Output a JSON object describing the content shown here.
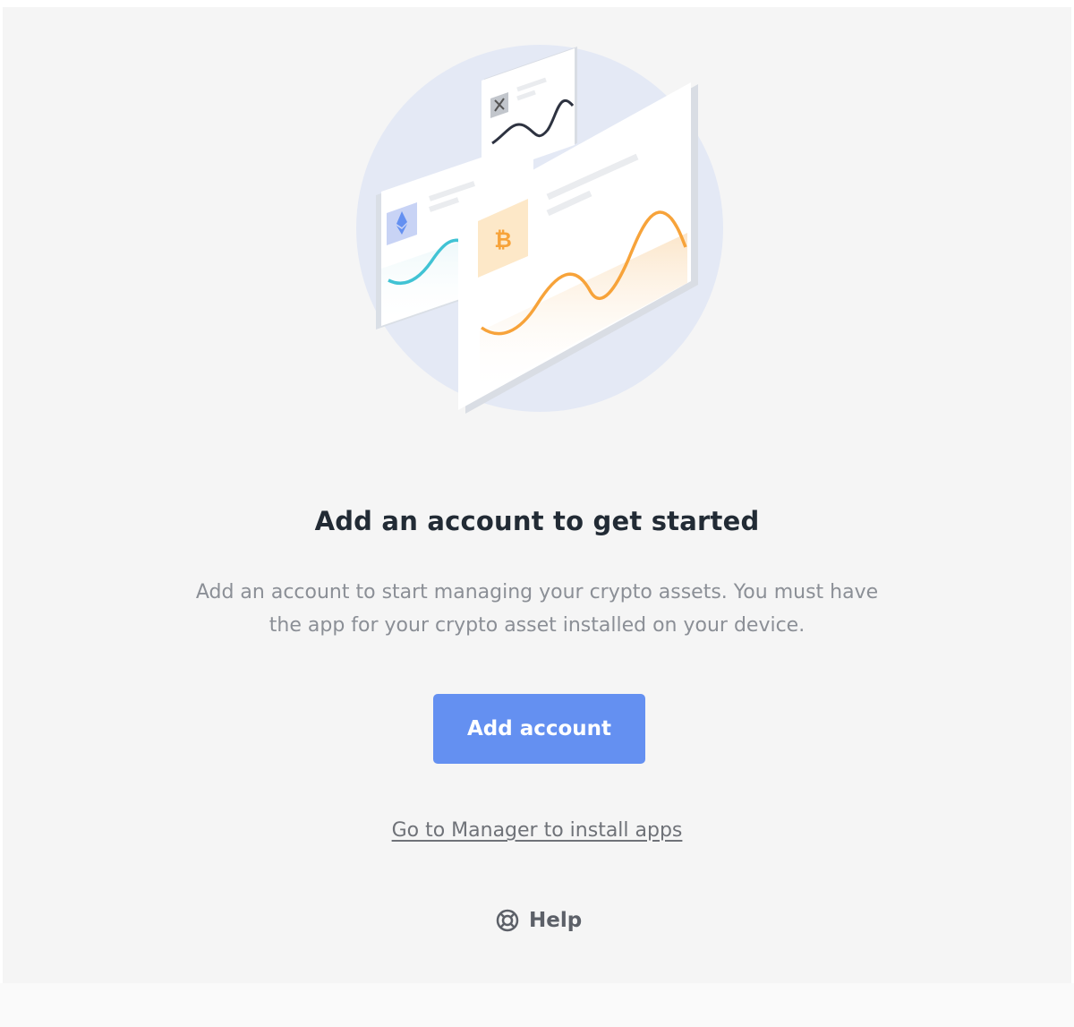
{
  "empty_state": {
    "title": "Add an account to get started",
    "description_line1": "Add an account to start managing your crypto assets. You must have",
    "description_line2": "the app for your crypto asset installed on your device.",
    "add_account_label": "Add account",
    "manager_link_label": "Go to Manager to install apps",
    "help_label": "Help"
  },
  "illustration": {
    "coins": [
      "ethereum-icon",
      "bitcoin-icon"
    ],
    "colors": {
      "circle": "#e4e9f5",
      "ethereum": "#6490f1",
      "ethereum_line": "#41c3d4",
      "bitcoin": "#f7a33a",
      "bitcoin_bg": "#fde8c8"
    }
  },
  "colors": {
    "button": "#6490f1",
    "title": "#222b35",
    "text": "#8b8f96"
  }
}
